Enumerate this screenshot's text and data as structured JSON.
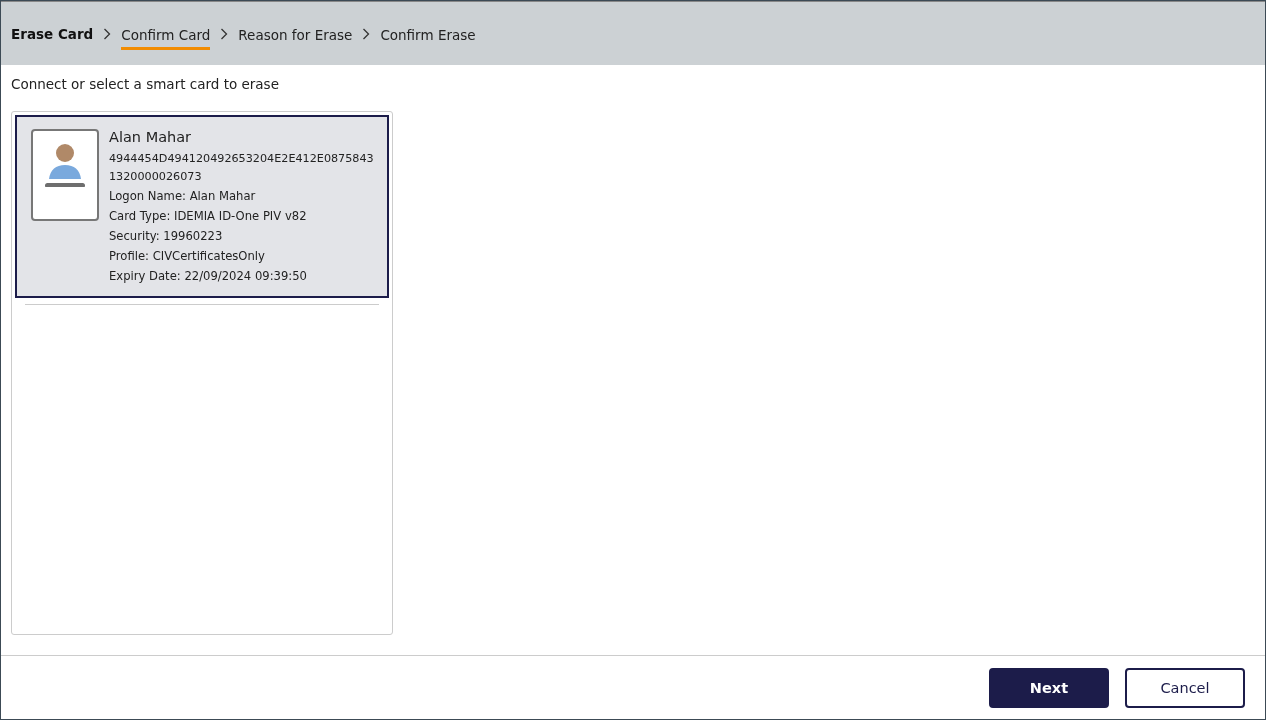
{
  "breadcrumb": {
    "title": "Erase Card",
    "steps": [
      {
        "label": "Confirm Card",
        "selected": true
      },
      {
        "label": "Reason for Erase",
        "selected": false
      },
      {
        "label": "Confirm Erase",
        "selected": false
      }
    ]
  },
  "instruction": "Connect or select a smart card to erase",
  "cards": [
    {
      "selected": true,
      "name": "Alan Mahar",
      "id_lines": [
        "4944454D494120492653204E2E412E0875843",
        "1320000026073"
      ],
      "details": [
        "Logon Name: Alan Mahar",
        "Card Type: IDEMIA ID-One PIV v82",
        "Security: 19960223",
        "Profile: CIVCertificatesOnly",
        "Expiry Date: 22/09/2024 09:39:50"
      ]
    }
  ],
  "buttons": [
    {
      "label": "Next",
      "kind": "primary"
    },
    {
      "label": "Cancel",
      "kind": "secondary"
    }
  ]
}
